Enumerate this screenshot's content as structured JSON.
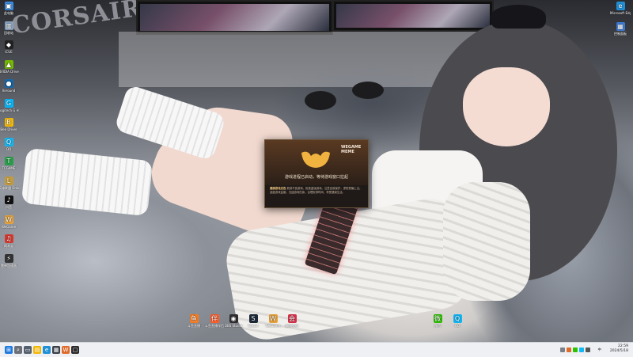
{
  "wallpaper": {
    "brand_text": "CORSAIR"
  },
  "desktop_left_icons": [
    {
      "label": "此电脑",
      "color": "#3a8ee6",
      "glyph": "▣"
    },
    {
      "label": "回收站",
      "color": "#8aa4c2",
      "glyph": "▥"
    },
    {
      "label": "iCUE",
      "color": "#222222",
      "glyph": "◆"
    },
    {
      "label": "NVIDIA Driver Hub",
      "color": "#76b900",
      "glyph": "▲"
    },
    {
      "label": "Xeround",
      "color": "#1769aa",
      "glyph": "●"
    },
    {
      "label": "Logitech G HUB",
      "color": "#00b8fc",
      "glyph": "G"
    },
    {
      "label": "Bee Driver",
      "color": "#f2b705",
      "glyph": "B"
    },
    {
      "label": "QQ",
      "color": "#12b7f5",
      "glyph": "Q"
    },
    {
      "label": "TCGAME",
      "color": "#2a9d4a",
      "glyph": "T"
    },
    {
      "label": "英雄联盟 Online",
      "color": "#c39b3c",
      "glyph": "L"
    },
    {
      "label": "抖音",
      "color": "#111111",
      "glyph": "♪"
    },
    {
      "label": "WeGame",
      "color": "#e6a23c",
      "glyph": "W"
    },
    {
      "label": "网易云",
      "color": "#d33a31",
      "glyph": "♫"
    },
    {
      "label": "雷神加速器",
      "color": "#333333",
      "glyph": "⚡"
    }
  ],
  "desktop_right_icons": [
    {
      "label": "Microsoft Edge",
      "color": "#1f8fd6",
      "glyph": "e"
    },
    {
      "label": "控制面板",
      "color": "#3b7dd8",
      "glyph": "▦"
    }
  ],
  "desktop_bottom_icons": [
    {
      "label": "斗鱼直播",
      "color": "#ff7a19",
      "glyph": "鱼"
    },
    {
      "label": "斗鱼直播伴侣",
      "color": "#ff5d2a",
      "glyph": "伴"
    },
    {
      "label": "OBS Studio",
      "color": "#302e31",
      "glyph": "◉"
    },
    {
      "label": "Steam",
      "color": "#1b2838",
      "glyph": "S"
    },
    {
      "label": "WeGame",
      "color": "#e6a23c",
      "glyph": "W"
    },
    {
      "label": "腾讯会议",
      "color": "#d9314b",
      "glyph": "会"
    },
    {
      "label": "微信",
      "color": "#2dc100",
      "glyph": "微"
    },
    {
      "label": "QQ",
      "color": "#12b7f5",
      "glyph": "Q"
    }
  ],
  "dialog": {
    "brand": "WEGAME MEME",
    "message": "游戏进程已启动，等待游戏窗口拉起",
    "foot_title": "健康游戏忠告",
    "foot_text": "抵制不良游戏，拒绝盗版游戏。注意自我保护，谨防受骗上当。适度游戏益脑，沉迷游戏伤身。合理安排时间，享受健康生活。"
  },
  "taskbar": {
    "apps": [
      {
        "name": "start",
        "color": "#1f7ae0",
        "glyph": "⊞"
      },
      {
        "name": "search",
        "color": "#6b6f78",
        "glyph": "⌕"
      },
      {
        "name": "task-view",
        "color": "#54606e",
        "glyph": "▭"
      },
      {
        "name": "file-explorer",
        "color": "#f2b705",
        "glyph": "▤"
      },
      {
        "name": "edge",
        "color": "#1f8fd6",
        "glyph": "e"
      },
      {
        "name": "store",
        "color": "#3a3f48",
        "glyph": "▦"
      },
      {
        "name": "wegame",
        "color": "#e06a2a",
        "glyph": "W"
      },
      {
        "name": "app",
        "color": "#2b2b2b",
        "glyph": "▢"
      }
    ],
    "tray_lang": "中",
    "clock_time": "22:59",
    "clock_date": "2024/5/18"
  }
}
